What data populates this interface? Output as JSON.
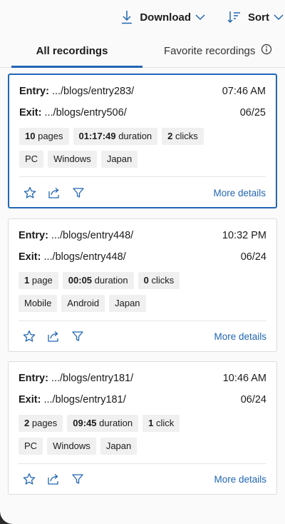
{
  "toolbar": {
    "download_label": "Download",
    "sort_label": "Sort"
  },
  "tabs": {
    "all": "All recordings",
    "favorite": "Favorite recordings"
  },
  "cards": [
    {
      "entry_label": "Entry:",
      "entry": ".../blogs/entry283/",
      "time": "07:46 AM",
      "exit_label": "Exit:",
      "exit": ".../blogs/entry506/",
      "date": "06/25",
      "pages_value": "10",
      "pages_unit": "pages",
      "duration_value": "01:17:49",
      "duration_unit": "duration",
      "clicks_value": "2",
      "clicks_unit": "clicks",
      "device": "PC",
      "os": "Windows",
      "country": "Japan",
      "more": "More details",
      "selected": true
    },
    {
      "entry_label": "Entry:",
      "entry": ".../blogs/entry448/",
      "time": "10:32 PM",
      "exit_label": "Exit:",
      "exit": ".../blogs/entry448/",
      "date": "06/24",
      "pages_value": "1",
      "pages_unit": "page",
      "duration_value": "00:05",
      "duration_unit": "duration",
      "clicks_value": "0",
      "clicks_unit": "clicks",
      "device": "Mobile",
      "os": "Android",
      "country": "Japan",
      "more": "More details",
      "selected": false
    },
    {
      "entry_label": "Entry:",
      "entry": ".../blogs/entry181/",
      "time": "10:46 AM",
      "exit_label": "Exit:",
      "exit": ".../blogs/entry181/",
      "date": "06/24",
      "pages_value": "2",
      "pages_unit": "pages",
      "duration_value": "09:45",
      "duration_unit": "duration",
      "clicks_value": "1",
      "clicks_unit": "click",
      "device": "PC",
      "os": "Windows",
      "country": "Japan",
      "more": "More details",
      "selected": false
    }
  ],
  "colors": {
    "accent": "#2266b3",
    "chip_bg": "#f0f0f0",
    "card_border": "#dcdcdc"
  }
}
